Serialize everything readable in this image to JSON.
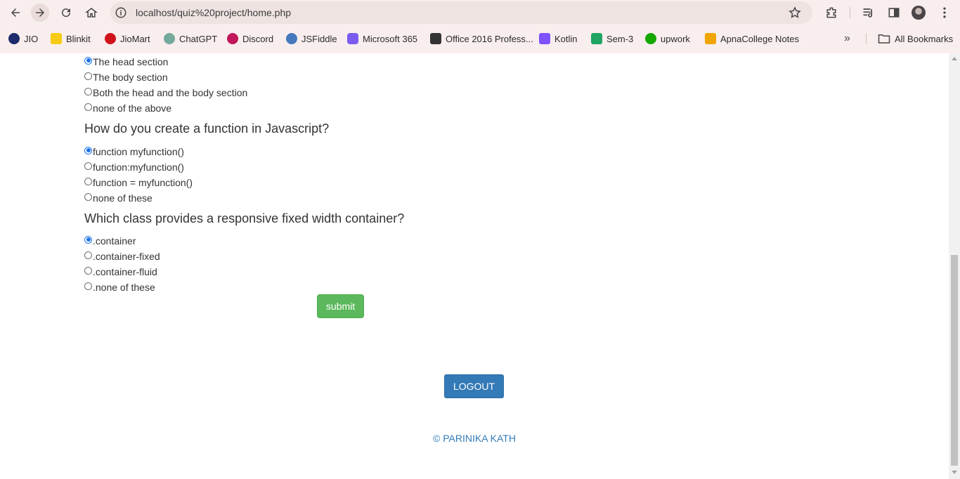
{
  "browser": {
    "url": "localhost/quiz%20project/home.php",
    "bookmarks": [
      {
        "label": "JIO",
        "color": "#1d2a6b"
      },
      {
        "label": "Blinkit",
        "color": "#f7cb15"
      },
      {
        "label": "JioMart",
        "color": "#d0121b"
      },
      {
        "label": "ChatGPT",
        "color": "#74aa9c"
      },
      {
        "label": "Discord",
        "color": "#c2185b"
      },
      {
        "label": "JSFiddle",
        "color": "#4679bd"
      },
      {
        "label": "Microsoft 365",
        "color": "#7b5cf0"
      },
      {
        "label": "Office 2016 Profess...",
        "color": "#333333"
      },
      {
        "label": "Kotlin",
        "color": "#7f52ff"
      },
      {
        "label": "Sem-3",
        "color": "#1fa463"
      },
      {
        "label": "upwork",
        "color": "#14a800"
      },
      {
        "label": "ApnaCollege Notes",
        "color": "#f0a500"
      }
    ],
    "all_bookmarks": "All Bookmarks"
  },
  "quiz": {
    "q1_options": [
      {
        "label": "The head section",
        "checked": true
      },
      {
        "label": "The body section",
        "checked": false
      },
      {
        "label": "Both the head and the body section",
        "checked": false
      },
      {
        "label": "none of the above",
        "checked": false
      }
    ],
    "q2": {
      "question": "How do you create a function in Javascript?",
      "options": [
        {
          "label": "function myfunction()",
          "checked": true
        },
        {
          "label": "function:myfunction()",
          "checked": false
        },
        {
          "label": "function = myfunction()",
          "checked": false
        },
        {
          "label": "none of these",
          "checked": false
        }
      ]
    },
    "q3": {
      "question": "Which class provides a responsive fixed width container?",
      "options": [
        {
          "label": ".container",
          "checked": true
        },
        {
          "label": ".container-fixed",
          "checked": false
        },
        {
          "label": ".container-fluid",
          "checked": false
        },
        {
          "label": ".none of these",
          "checked": false
        }
      ]
    },
    "submit_label": "submit"
  },
  "logout_label": "LOGOUT",
  "footer": "© PARINIKA KATH",
  "colors": {
    "submit": "#5cb85c",
    "logout": "#337ab7",
    "radio_checked": "#1a73e8"
  }
}
